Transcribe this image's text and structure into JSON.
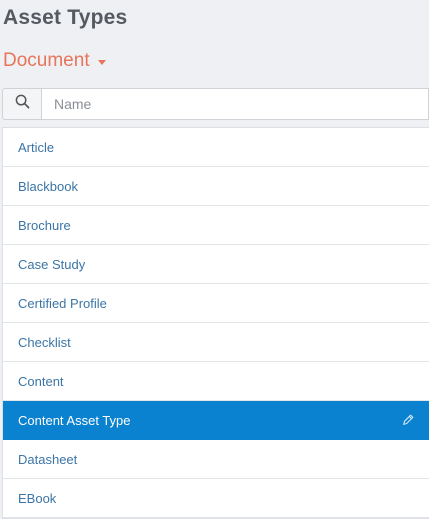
{
  "header": {
    "title": "Asset Types"
  },
  "filter": {
    "selected": "Document"
  },
  "search": {
    "placeholder": "Name",
    "value": ""
  },
  "asset_types": [
    {
      "label": "Article",
      "selected": false
    },
    {
      "label": "Blackbook",
      "selected": false
    },
    {
      "label": "Brochure",
      "selected": false
    },
    {
      "label": "Case Study",
      "selected": false
    },
    {
      "label": "Certified Profile",
      "selected": false
    },
    {
      "label": "Checklist",
      "selected": false
    },
    {
      "label": "Content",
      "selected": false
    },
    {
      "label": "Content Asset Type",
      "selected": true
    },
    {
      "label": "Datasheet",
      "selected": false
    },
    {
      "label": "EBook",
      "selected": false
    }
  ],
  "icons": {
    "search": "search-icon",
    "edit": "pencil-icon",
    "dropdown": "caret-down-icon"
  },
  "colors": {
    "accent": "#e8745a",
    "selection": "#0a82cf",
    "link": "#3b75a6"
  }
}
